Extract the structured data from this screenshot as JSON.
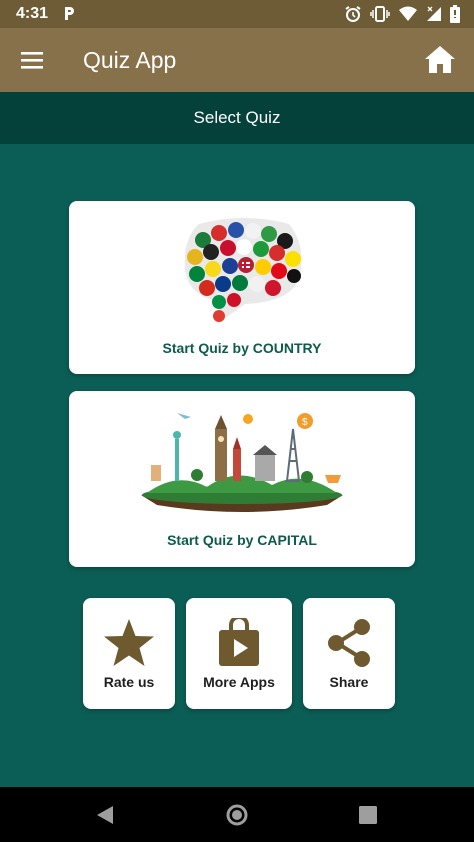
{
  "status_bar": {
    "time": "4:31",
    "icons": [
      "pocket-icon",
      "alarm-icon",
      "vibrate-icon",
      "wifi-icon",
      "signal-icon",
      "battery-icon"
    ]
  },
  "app_bar": {
    "title": "Quiz App",
    "menu_icon": "hamburger-menu-icon",
    "home_icon": "home-icon"
  },
  "subheader": {
    "title": "Select Quiz"
  },
  "quiz_options": [
    {
      "label": "Start Quiz by COUNTRY",
      "image": "world-flags-speech-bubble-image"
    },
    {
      "label": "Start Quiz by CAPITAL",
      "image": "world-landmarks-island-image"
    }
  ],
  "actions": [
    {
      "label": "Rate us",
      "icon": "star-icon"
    },
    {
      "label": "More Apps",
      "icon": "play-store-bag-icon"
    },
    {
      "label": "Share",
      "icon": "share-icon"
    }
  ],
  "nav_bar": {
    "buttons": [
      "back-icon",
      "home-circle-icon",
      "recents-square-icon"
    ]
  },
  "colors": {
    "status_bar": "#6e5c37",
    "app_bar": "#87714a",
    "subheader": "#04413b",
    "background": "#0b5e55",
    "card_label": "#0d5b4d",
    "action_icon": "#6f5a2f"
  }
}
